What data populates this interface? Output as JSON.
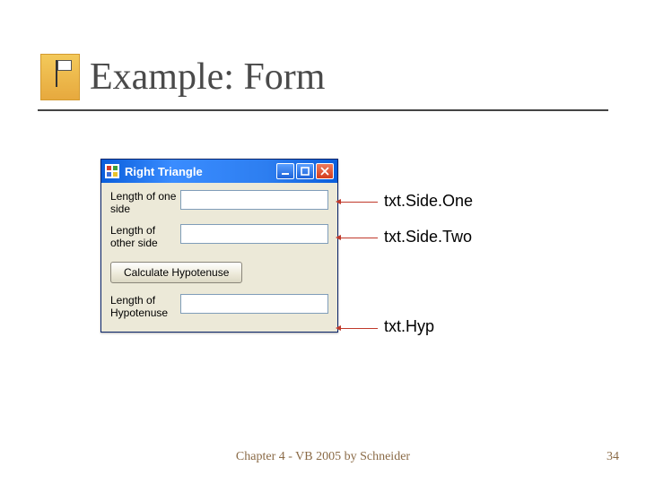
{
  "slide": {
    "title": "Example: Form",
    "footer": "Chapter 4 - VB 2005 by Schneider",
    "page_number": "34"
  },
  "window": {
    "title": "Right Triangle",
    "rows": {
      "sideOne": {
        "label": "Length of one side",
        "value": ""
      },
      "sideTwo": {
        "label": "Length of other side",
        "value": ""
      },
      "hyp": {
        "label": "Length of Hypotenuse",
        "value": ""
      }
    },
    "button_label": "Calculate Hypotenuse"
  },
  "callouts": {
    "sideOne": "txt.Side.One",
    "sideTwo": "txt.Side.Two",
    "hyp": "txt.Hyp"
  }
}
